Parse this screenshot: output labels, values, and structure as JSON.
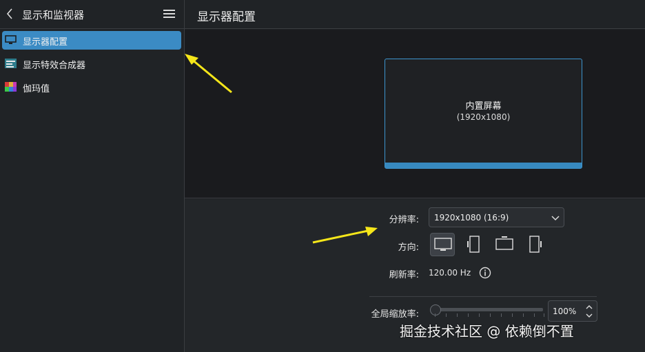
{
  "sidebar": {
    "title": "显示和监视器",
    "items": [
      {
        "label": "显示器配置",
        "icon": "monitor-icon",
        "active": true
      },
      {
        "label": "显示特效合成器",
        "icon": "compositor-icon",
        "active": false
      },
      {
        "label": "伽玛值",
        "icon": "gamma-icon",
        "active": false
      }
    ]
  },
  "main": {
    "title": "显示器配置",
    "preview": {
      "screen_name": "内置屏幕",
      "screen_resolution": "(1920x1080)"
    },
    "settings": {
      "resolution_label": "分辨率:",
      "resolution_value": "1920x1080 (16:9)",
      "orientation_label": "方向:",
      "refresh_label": "刷新率:",
      "refresh_value": "120.00 Hz",
      "scale_label": "全局缩放率:",
      "scale_value": "100%"
    }
  },
  "watermark": "掘金技术社区 @ 依赖倒不置",
  "colors": {
    "accent": "#3b8bc4",
    "annotation_arrow": "#f5e61a"
  }
}
